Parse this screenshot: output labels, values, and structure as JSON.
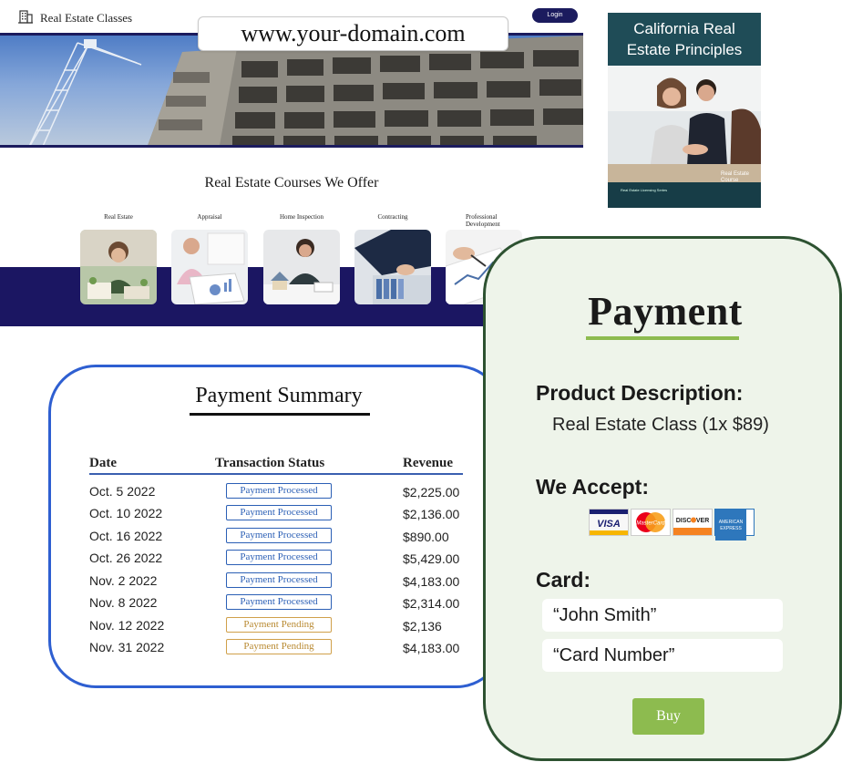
{
  "site": {
    "title": "Real Estate Classes",
    "login_label": "Login",
    "url": "www.your-domain.com"
  },
  "courses": {
    "heading": "Real Estate Courses We Offer",
    "items": [
      {
        "label": "Real Estate"
      },
      {
        "label": "Appraisal"
      },
      {
        "label": "Home Inspection"
      },
      {
        "label": "Contracting"
      },
      {
        "label": "Professional Development"
      }
    ]
  },
  "book": {
    "title_line1": "California Real",
    "title_line2": "Estate Principles",
    "course_label": "Real Estate Course",
    "series_label": "Real Estate Licensing Series"
  },
  "summary": {
    "title": "Payment Summary",
    "columns": [
      "Date",
      "Transaction Status",
      "Revenue"
    ],
    "rows": [
      {
        "date": "Oct. 5 2022",
        "status": "Payment Processed",
        "revenue": "$2,225.00"
      },
      {
        "date": "Oct. 10 2022",
        "status": "Payment Processed",
        "revenue": "$2,136.00"
      },
      {
        "date": "Oct. 16 2022",
        "status": "Payment Processed",
        "revenue": "$890.00"
      },
      {
        "date": "Oct. 26 2022",
        "status": "Payment Processed",
        "revenue": "$5,429.00"
      },
      {
        "date": "Nov. 2 2022",
        "status": "Payment Processed",
        "revenue": "$4,183.00"
      },
      {
        "date": "Nov. 8 2022",
        "status": "Payment Processed",
        "revenue": "$2,314.00"
      },
      {
        "date": "Nov. 12 2022",
        "status": "Payment Pending",
        "revenue": "$2,136"
      },
      {
        "date": "Nov. 31 2022",
        "status": "Payment Pending",
        "revenue": "$4,183.00"
      }
    ],
    "colors": {
      "processed": "#2b5fb5",
      "pending": "#b98a32"
    }
  },
  "payment": {
    "title": "Payment",
    "product_label": "Product Description:",
    "product_value": "Real Estate Class (1x $89)",
    "accept_label": "We Accept:",
    "cards": [
      {
        "name": "visa-card-icon",
        "text": "VISA"
      },
      {
        "name": "mastercard-icon",
        "text": "MasterCard"
      },
      {
        "name": "discover-card-icon",
        "text": "DISCOVER"
      },
      {
        "name": "amex-card-icon",
        "text": "AMERICAN EXPRESS"
      }
    ],
    "card_label": "Card:",
    "name_field": "“John Smith”",
    "number_field": "“Card Number”",
    "buy_label": "Buy",
    "accent": "#8dbb4f"
  }
}
